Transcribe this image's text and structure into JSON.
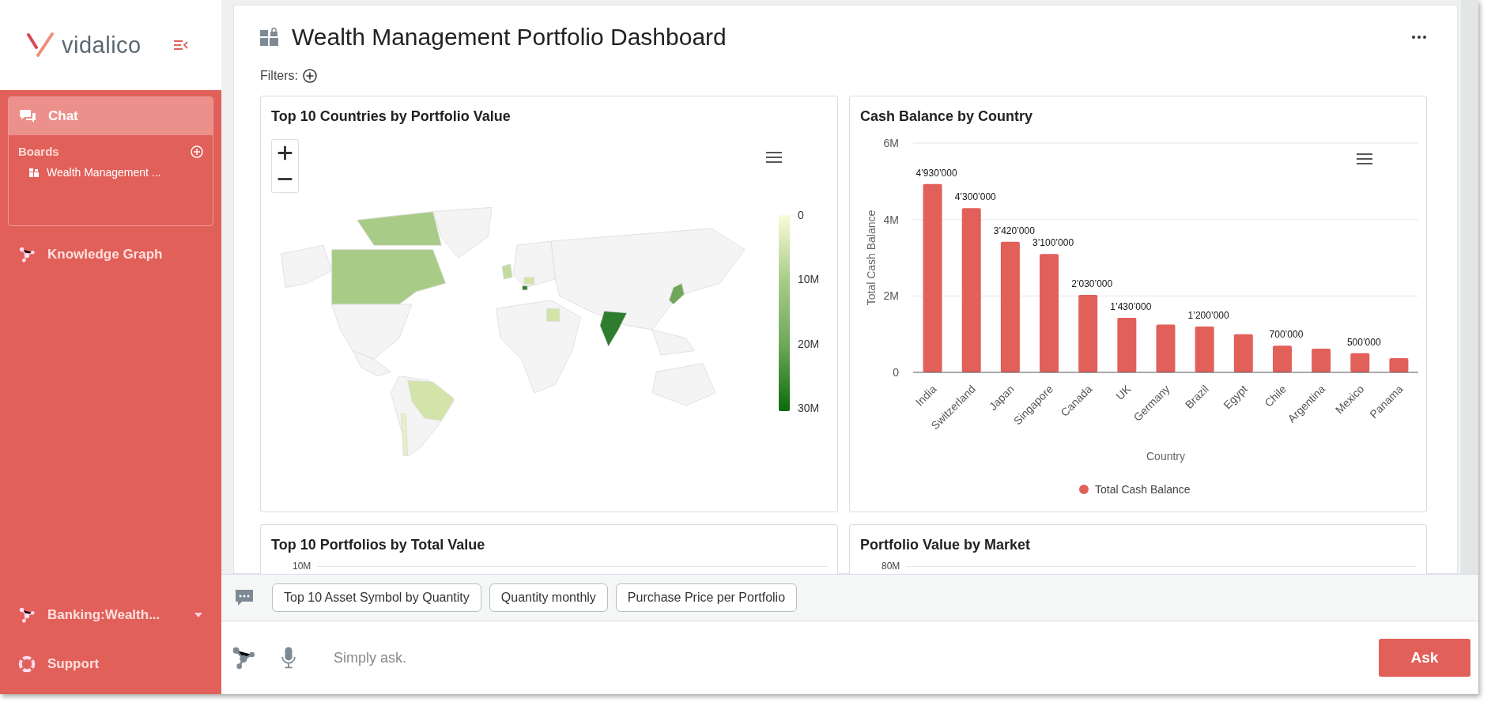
{
  "sidebar": {
    "logo": "vidalico",
    "nav": [
      {
        "kind": "chat",
        "label": "Chat",
        "selected": true
      },
      {
        "kind": "graph",
        "label": "Knowledge Graph",
        "selected": false
      }
    ],
    "boards": {
      "title": "Boards",
      "items": [
        {
          "label": "Wealth Management ..."
        }
      ]
    },
    "bottom": [
      {
        "kind": "workspace",
        "label": "Banking:Wealth..."
      },
      {
        "kind": "support",
        "label": "Support"
      }
    ]
  },
  "dashboard": {
    "title": "Wealth Management Portfolio Dashboard",
    "filters_label": "Filters:",
    "map_card": {
      "title": "Top 10 Countries by Portfolio Value",
      "legend_ticks": [
        "0",
        "10M",
        "20M",
        "30M"
      ]
    },
    "bar_card": {
      "title": "Cash Balance by Country",
      "chart_data": {
        "type": "bar",
        "xlabel": "Country",
        "ylabel": "Total Cash Balance",
        "categories": [
          "India",
          "Switzerland",
          "Japan",
          "Singapore",
          "Canada",
          "UK",
          "Germany",
          "Brazil",
          "Egypt",
          "Chile",
          "Argentina",
          "Mexico",
          "Panama"
        ],
        "series": [
          {
            "name": "Total Cash Balance",
            "color": "#e2605a",
            "values": [
              4930000,
              4300000,
              3420000,
              3100000,
              2030000,
              1430000,
              1250000,
              1200000,
              1000000,
              700000,
              620000,
              500000,
              370000
            ]
          }
        ],
        "value_labels": [
          "4’930’000",
          "4’300’000",
          "3’420’000",
          "3’100’000",
          "2’030’000",
          "1’430’000",
          null,
          "1’200’000",
          null,
          "700’000",
          null,
          "500’000",
          null
        ],
        "ylim": [
          0,
          6000000
        ],
        "yticks": [
          {
            "value": 0,
            "label": "0"
          },
          {
            "value": 2000000,
            "label": "2M"
          },
          {
            "value": 4000000,
            "label": "4M"
          },
          {
            "value": 6000000,
            "label": "6M"
          }
        ]
      }
    },
    "lower_cards": [
      {
        "title": "Top 10 Portfolios by Total Value",
        "top_tick": "10M"
      },
      {
        "title": "Portfolio Value by Market",
        "top_tick": "80M"
      }
    ]
  },
  "suggestions": [
    "Top 10 Asset Symbol by Quantity",
    "Quantity monthly",
    "Purchase Price per Portfolio"
  ],
  "ask": {
    "placeholder": "Simply ask.",
    "button": "Ask"
  }
}
